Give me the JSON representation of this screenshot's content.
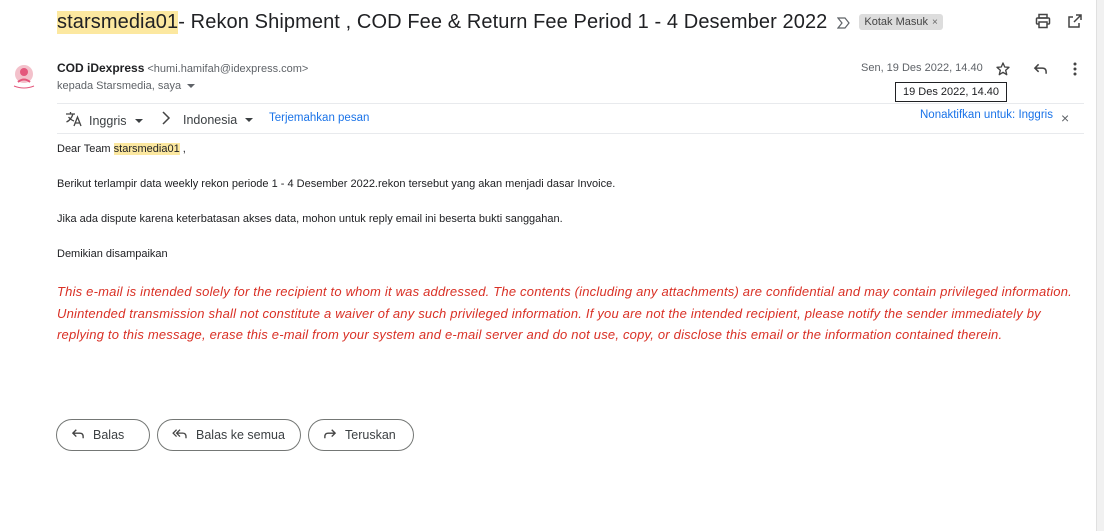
{
  "subject": {
    "highlight": "starsmedia01",
    "rest": " - Rekon Shipment , COD Fee & Return Fee Period 1 - 4 Desember 2022",
    "label": "Kotak Masuk",
    "label_remove": "×"
  },
  "sender": {
    "name": "COD iDexpress",
    "email": "<humi.hamifah@idexpress.com>",
    "recipients": "kepada Starsmedia, saya"
  },
  "meta": {
    "date": "Sen, 19 Des 2022, 14.40",
    "tooltip": "19 Des 2022, 14.40"
  },
  "translate": {
    "source_lang": "Inggris",
    "target_lang": "Indonesia",
    "translate_link": "Terjemahkan pesan",
    "disable_link": "Nonaktifkan untuk: Inggris",
    "close": "×"
  },
  "body": {
    "greeting_prefix": "Dear Team ",
    "greeting_highlight": "starsmedia01",
    "greeting_suffix": " ,",
    "para1": "Berikut terlampir data weekly rekon periode 1 - 4 Desember 2022.rekon tersebut yang akan menjadi dasar Invoice.",
    "para2": "Jika ada dispute karena keterbatasan akses data, mohon untuk reply email ini beserta bukti sanggahan.",
    "para3": "Demikian disampaikan",
    "disclaimer": "This e-mail is intended solely for the recipient to whom it was addressed. The contents (including any attachments) are confidential and may contain privileged information. Unintended transmission shall not constitute a waiver of any such privileged information. If you are not the intended recipient, please notify the sender immediately by replying to this message, erase this e-mail from your system and e-mail server and do not use, copy, or disclose this email or the information contained therein."
  },
  "actions": {
    "reply": "Balas",
    "reply_all": "Balas ke semua",
    "forward": "Teruskan"
  },
  "colors": {
    "highlight": "#fce8a0",
    "disclaimer": "#d93025",
    "link": "#1a73e8"
  }
}
